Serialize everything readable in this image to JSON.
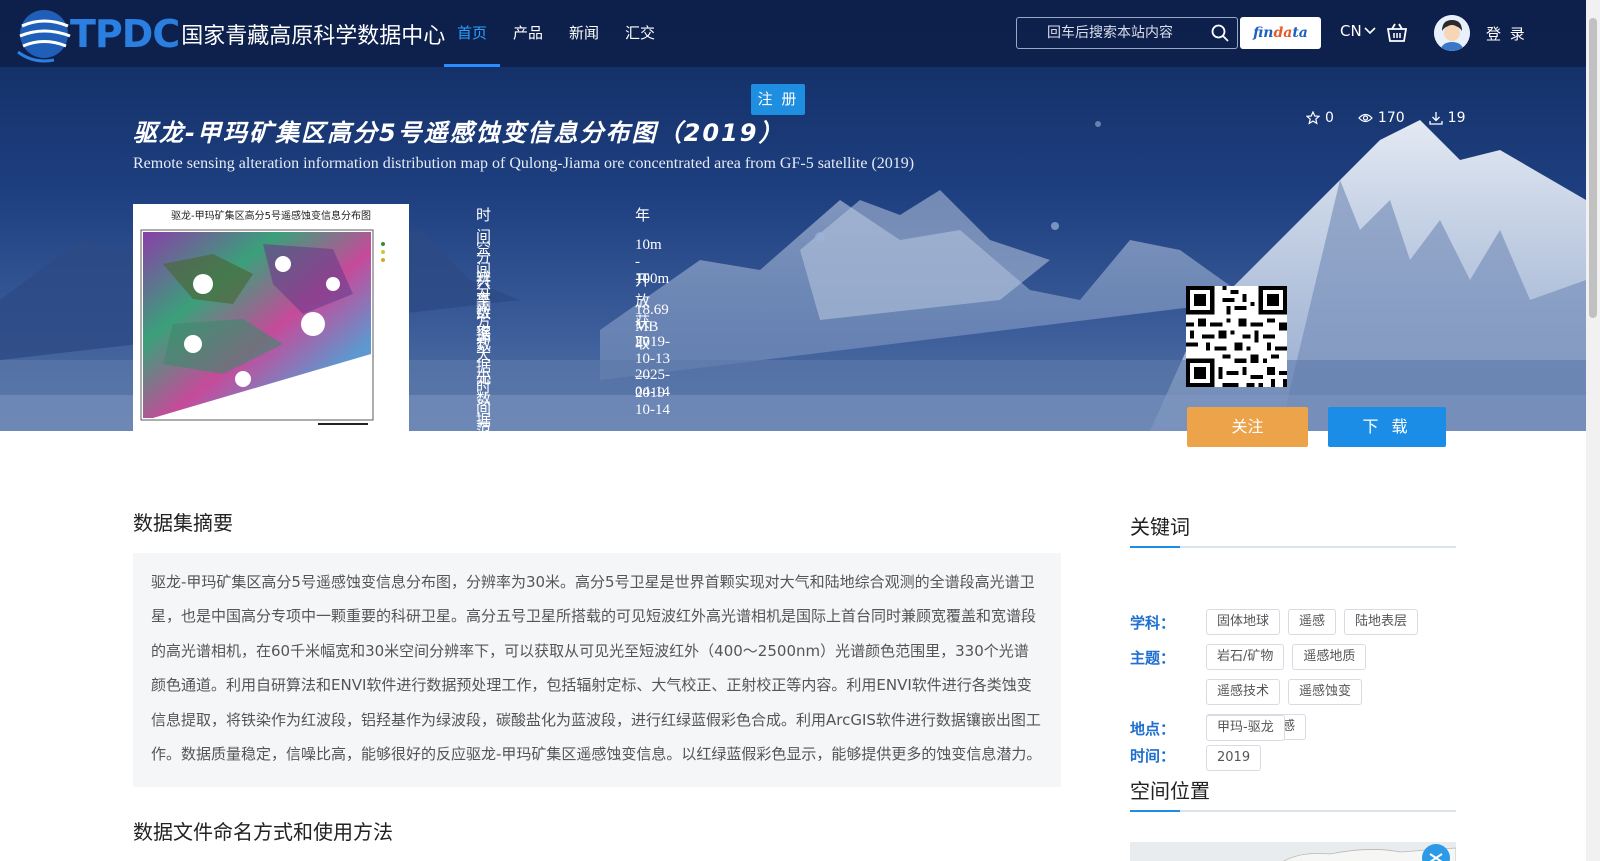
{
  "header": {
    "logo_text": "TPDC",
    "logo_cn": "国家青藏高原科学数据中心",
    "nav": [
      {
        "label": "首页"
      },
      {
        "label": "产品"
      },
      {
        "label": "新闻"
      },
      {
        "label": "汇交"
      }
    ],
    "search_placeholder": "回车后搜索本站内容",
    "findata_a": "fin",
    "findata_b": "da",
    "findata_c": "ta",
    "lang": "CN",
    "login": "登 录",
    "register": "注 册"
  },
  "dataset": {
    "title_cn": "驱龙-甲玛矿集区高分5号遥感蚀变信息分布图（2019）",
    "title_en": "Remote sensing alteration information distribution map of Qulong-Jiama ore concentrated area from GF-5 satellite (2019)",
    "stats": {
      "stars": "0",
      "views": "170",
      "downloads": "19"
    },
    "thumb_title": "驱龙-甲玛矿集区高分5号遥感蚀变信息分布图",
    "meta": [
      {
        "key": "时间分辨率",
        "value": "年"
      },
      {
        "key": "空间分辨率",
        "value": "10m - 100m"
      },
      {
        "key": "共享方式",
        "value": "开放获取"
      },
      {
        "key": "数据大小",
        "value": "18.69 MB"
      },
      {
        "key": "数据时间范围",
        "value": "2019-10-13 — 2019-10-14"
      },
      {
        "key": "元数据更新时间",
        "value": "2025-04-14"
      }
    ],
    "follow_label": "关注",
    "download_label": "下 载"
  },
  "abstract": {
    "title": "数据集摘要",
    "text": "驱龙-甲玛矿集区高分5号遥感蚀变信息分布图，分辨率为30米。高分5号卫星是世界首颗实现对大气和陆地综合观测的全谱段高光谱卫星，也是中国高分专项中一颗重要的科研卫星。高分五号卫星所搭载的可见短波红外高光谱相机是国际上首台同时兼顾宽覆盖和宽谱段的高光谱相机，在60千米幅宽和30米空间分辨率下，可以获取从可见光至短波红外（400～2500nm）光谱颜色范围里，330个光谱颜色通道。利用自研算法和ENVI软件进行数据预处理工作，包括辐射定标、大气校正、正射校正等内容。利用ENVI软件进行各类蚀变信息提取，将铁染作为红波段，铝羟基作为绿波段，碳酸盐化为蓝波段，进行红绿蓝假彩色合成。利用ArcGIS软件进行数据镶嵌出图工作。数据质量稳定，信噪比高，能够很好的反应驱龙-甲玛矿集区遥感蚀变信息。以红绿蓝假彩色显示，能够提供更多的蚀变信息潜力。"
  },
  "file_naming": {
    "title": "数据文件命名方式和使用方法"
  },
  "keywords": {
    "title": "关键词",
    "groups": [
      {
        "label": "学科：",
        "tags": [
          "固体地球",
          "遥感",
          "陆地表层"
        ]
      },
      {
        "label": "主题：",
        "tags": [
          "岩石/矿物",
          "遥感地质",
          "遥感技术",
          "遥感蚀变",
          "陆地表层遥感"
        ]
      },
      {
        "label": "地点：",
        "tags": [
          "甲玛-驱龙"
        ]
      },
      {
        "label": "时间：",
        "tags": [
          "2019"
        ]
      }
    ]
  },
  "spatial": {
    "title": "空间位置"
  },
  "colors": {
    "accent": "#1c8de6",
    "follow": "#eda34a",
    "keyword_label": "#1e6fd0"
  }
}
